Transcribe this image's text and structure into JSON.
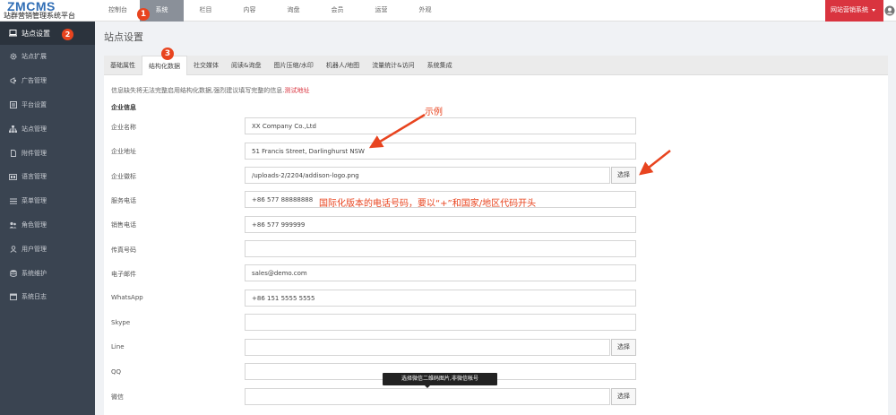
{
  "logo": {
    "main": "ZMCMS",
    "sub": "站群营销管理系统平台"
  },
  "nav": {
    "items": [
      "控制台",
      "系统",
      "栏目",
      "内容",
      "询盘",
      "会员",
      "运营",
      "外观"
    ],
    "active_index": 1,
    "badge": "1"
  },
  "header": {
    "site_button": "网站营销系统"
  },
  "sidebar": {
    "badge": "2",
    "items": [
      {
        "label": "站点设置",
        "icon": "laptop-icon"
      },
      {
        "label": "站点扩展",
        "icon": "gear-icon"
      },
      {
        "label": "广告管理",
        "icon": "megaphone-icon"
      },
      {
        "label": "平台设置",
        "icon": "list-icon"
      },
      {
        "label": "站点管理",
        "icon": "sitemap-icon"
      },
      {
        "label": "附件管理",
        "icon": "file-icon"
      },
      {
        "label": "语言管理",
        "icon": "language-icon"
      },
      {
        "label": "菜单管理",
        "icon": "menu-icon"
      },
      {
        "label": "角色管理",
        "icon": "users-icon"
      },
      {
        "label": "用户管理",
        "icon": "user-icon"
      },
      {
        "label": "系统维护",
        "icon": "database-icon"
      },
      {
        "label": "系统日志",
        "icon": "calendar-icon"
      }
    ]
  },
  "page": {
    "title": "站点设置"
  },
  "tabs": {
    "items": [
      "基础属性",
      "结构化数据",
      "社交媒体",
      "阅读&询盘",
      "图片压缩/水印",
      "机器人/地图",
      "流量统计&访问",
      "系统集成"
    ],
    "active_index": 1,
    "badge": "3"
  },
  "form": {
    "notice": "信息缺失将无法完整启用结构化数据,强烈建议填写完整的信息.",
    "notice_link": "测试地址",
    "section_title": "企业信息",
    "select_label": "选择",
    "fields": [
      {
        "label": "企业名称",
        "value": "XX Company Co.,Ltd"
      },
      {
        "label": "企业地址",
        "value": "51 Francis Street, Darlinghurst NSW"
      },
      {
        "label": "企业徽标",
        "value": "/uploads-2/2204/addison-logo.png"
      },
      {
        "label": "服务电话",
        "value": "+86 577 88888888"
      },
      {
        "label": "销售电话",
        "value": "+86 577 999999"
      },
      {
        "label": "传真号码",
        "value": ""
      },
      {
        "label": "电子邮件",
        "value": "sales@demo.com"
      },
      {
        "label": "WhatsApp",
        "value": "+86 151 5555 5555"
      },
      {
        "label": "Skype",
        "value": ""
      },
      {
        "label": "Line",
        "value": ""
      },
      {
        "label": "QQ",
        "value": ""
      },
      {
        "label": "微信",
        "value": ""
      }
    ]
  },
  "annotations": {
    "example": "示例",
    "phone_note": "国际化版本的电话号码，要以“+”和国家/地区代码开头",
    "wechat_tooltip": "选择微信二维码图片,非微信帐号"
  },
  "colors": {
    "accent_red": "#d9343f",
    "annotation_red": "#e8441f",
    "sidebar_bg": "#3a4451"
  }
}
